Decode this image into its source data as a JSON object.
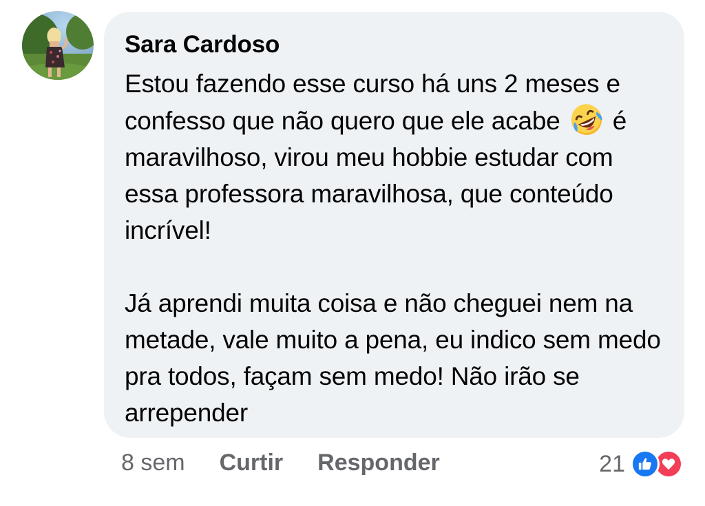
{
  "comment": {
    "author": "Sara Cardoso",
    "body": {
      "line1_before_emoji": "Estou fazendo esse curso há uns 2 meses e confesso que não quero que ele acabe",
      "emoji_icon": "rolling-on-floor-laughing-emoji",
      "line1_after_emoji": "é maravilhoso, virou meu hobbie estudar com essa professora maravilhosa, que conteúdo incrível!",
      "paragraph2": "Já aprendi muita coisa e não cheguei nem na metade, vale muito a pena, eu indico sem medo pra todos, façam sem medo! Não irão se arrepender"
    },
    "timestamp": "8 sem",
    "actions": {
      "like_label": "Curtir",
      "reply_label": "Responder"
    },
    "reactions": {
      "count": "21",
      "icons": [
        "like-icon",
        "love-icon"
      ],
      "like_color": "#1877f2",
      "love_color": "#f33e58"
    }
  },
  "colors": {
    "bubble_bg": "#eff2f5",
    "text": "#050505",
    "secondary_text": "#65676b"
  }
}
